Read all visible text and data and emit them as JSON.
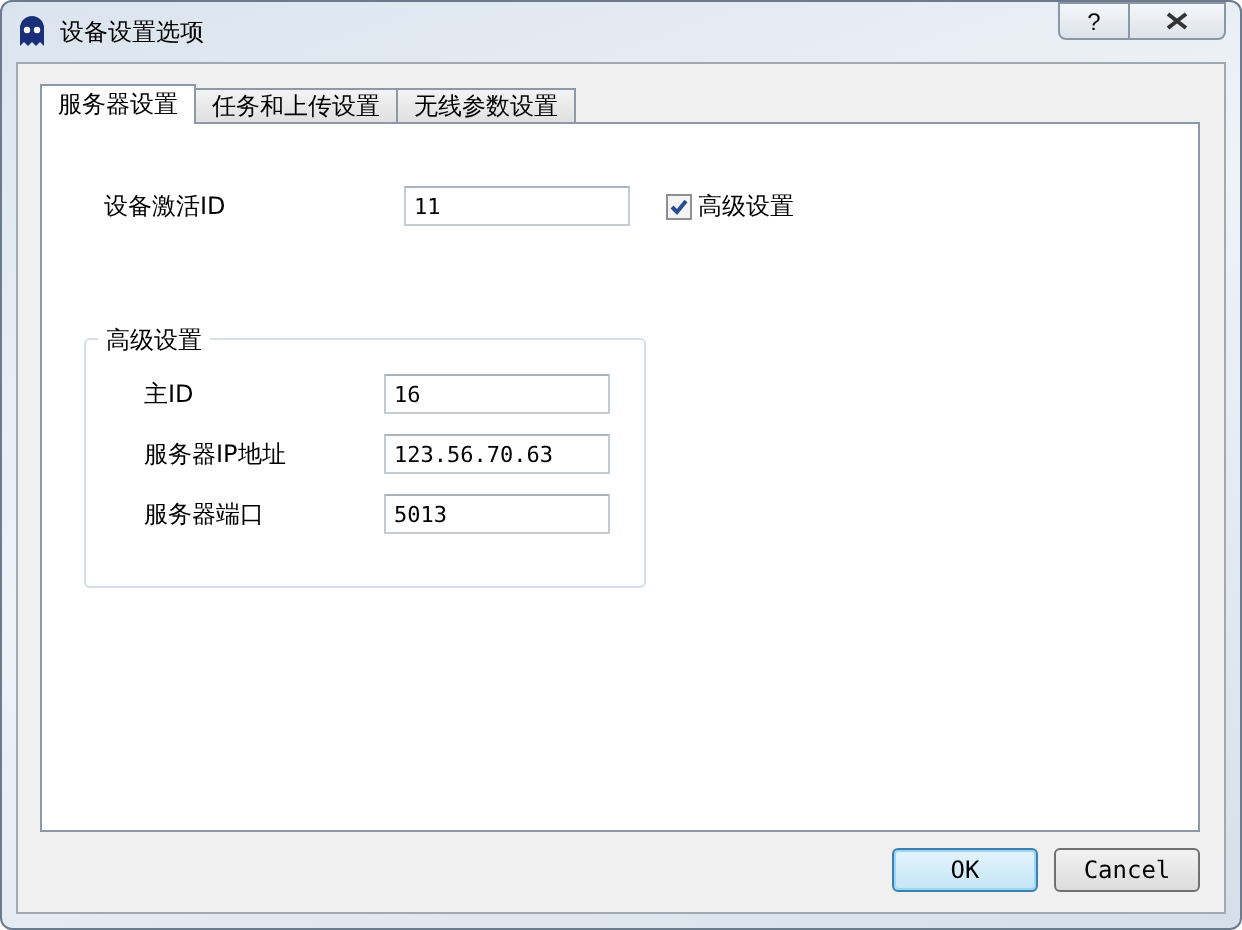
{
  "window": {
    "title": "设备设置选项",
    "help_button": "?"
  },
  "tabs": [
    {
      "label": "服务器设置",
      "selected": true
    },
    {
      "label": "任务和上传设置",
      "selected": false
    },
    {
      "label": "无线参数设置",
      "selected": false
    }
  ],
  "activation": {
    "label": "设备激活ID",
    "value": "11"
  },
  "advanced_checkbox": {
    "label": "高级设置",
    "checked": true
  },
  "advanced_group": {
    "title": "高级设置",
    "fields": [
      {
        "label": "主ID",
        "value": "16"
      },
      {
        "label": "服务器IP地址",
        "value": "123.56.70.63"
      },
      {
        "label": "服务器端口",
        "value": "5013"
      }
    ]
  },
  "buttons": [
    {
      "label": "OK",
      "kind": "default"
    },
    {
      "label": "Cancel",
      "kind": "normal"
    }
  ]
}
